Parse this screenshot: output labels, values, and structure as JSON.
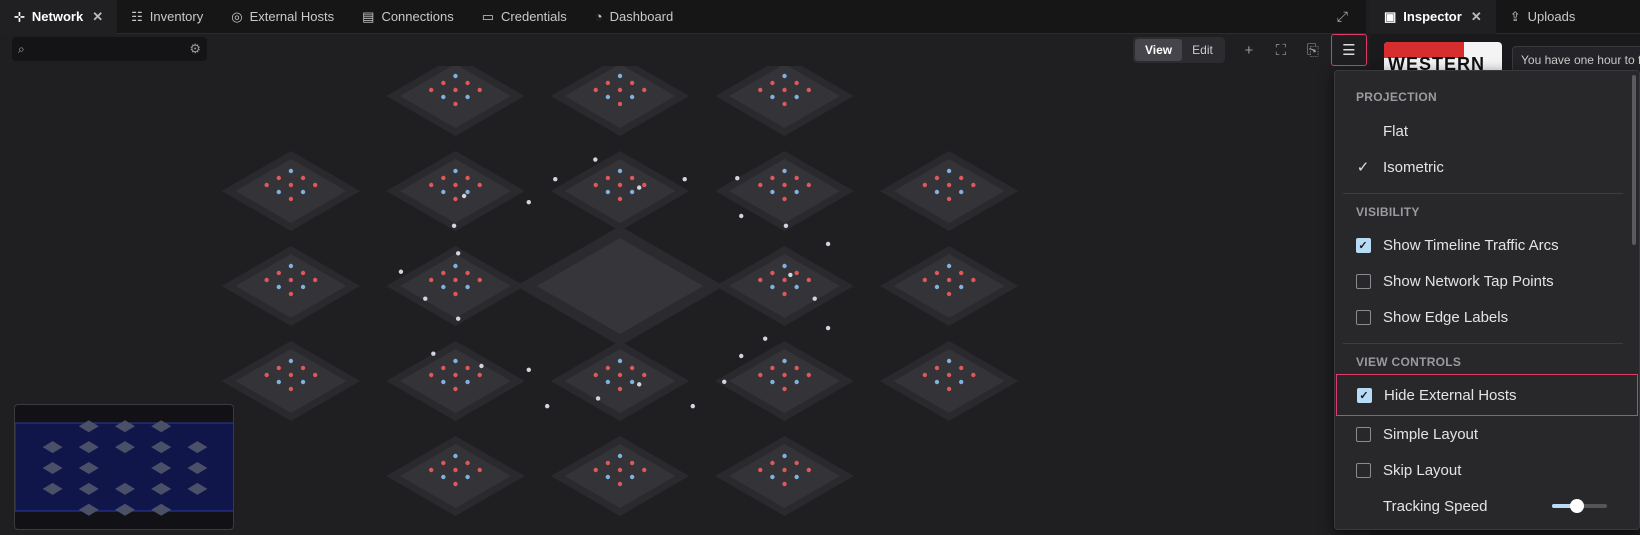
{
  "tabs": [
    {
      "label": "Network",
      "icon": "network-icon",
      "active": true,
      "closable": true
    },
    {
      "label": "Inventory",
      "icon": "list-icon"
    },
    {
      "label": "External Hosts",
      "icon": "globe-icon"
    },
    {
      "label": "Connections",
      "icon": "link-icon"
    },
    {
      "label": "Credentials",
      "icon": "key-icon"
    },
    {
      "label": "Dashboard",
      "icon": "gauge-icon"
    }
  ],
  "right_tabs": [
    {
      "label": "Inspector",
      "icon": "inspector-icon",
      "active": true,
      "closable": true
    },
    {
      "label": "Uploads",
      "icon": "upload-icon"
    }
  ],
  "search": {
    "placeholder": "",
    "value": ""
  },
  "view_toggle": {
    "view": "View",
    "edit": "Edit",
    "selected": "View"
  },
  "inspector": {
    "logo_text": "WESTERN",
    "note": "You have one hour to f"
  },
  "menu": {
    "sections": [
      {
        "title": "PROJECTION",
        "items": [
          {
            "label": "Flat",
            "type": "radio",
            "checked": false
          },
          {
            "label": "Isometric",
            "type": "radio",
            "checked": true
          }
        ]
      },
      {
        "title": "VISIBILITY",
        "items": [
          {
            "label": "Show Timeline Traffic Arcs",
            "type": "checkbox",
            "checked": true
          },
          {
            "label": "Show Network Tap Points",
            "type": "checkbox",
            "checked": false
          },
          {
            "label": "Show Edge Labels",
            "type": "checkbox",
            "checked": false
          }
        ]
      },
      {
        "title": "VIEW CONTROLS",
        "items": [
          {
            "label": "Hide External Hosts",
            "type": "checkbox",
            "checked": true,
            "highlighted": true
          },
          {
            "label": "Simple Layout",
            "type": "checkbox",
            "checked": false
          },
          {
            "label": "Skip Layout",
            "type": "checkbox",
            "checked": false
          },
          {
            "label": "Tracking Speed",
            "type": "slider",
            "value": 0.45
          }
        ]
      }
    ]
  },
  "colors": {
    "accent": "#b9dcf6",
    "highlight": "#e03a6b",
    "node_red": "#e0585a",
    "node_blue": "#7fb2e0"
  }
}
